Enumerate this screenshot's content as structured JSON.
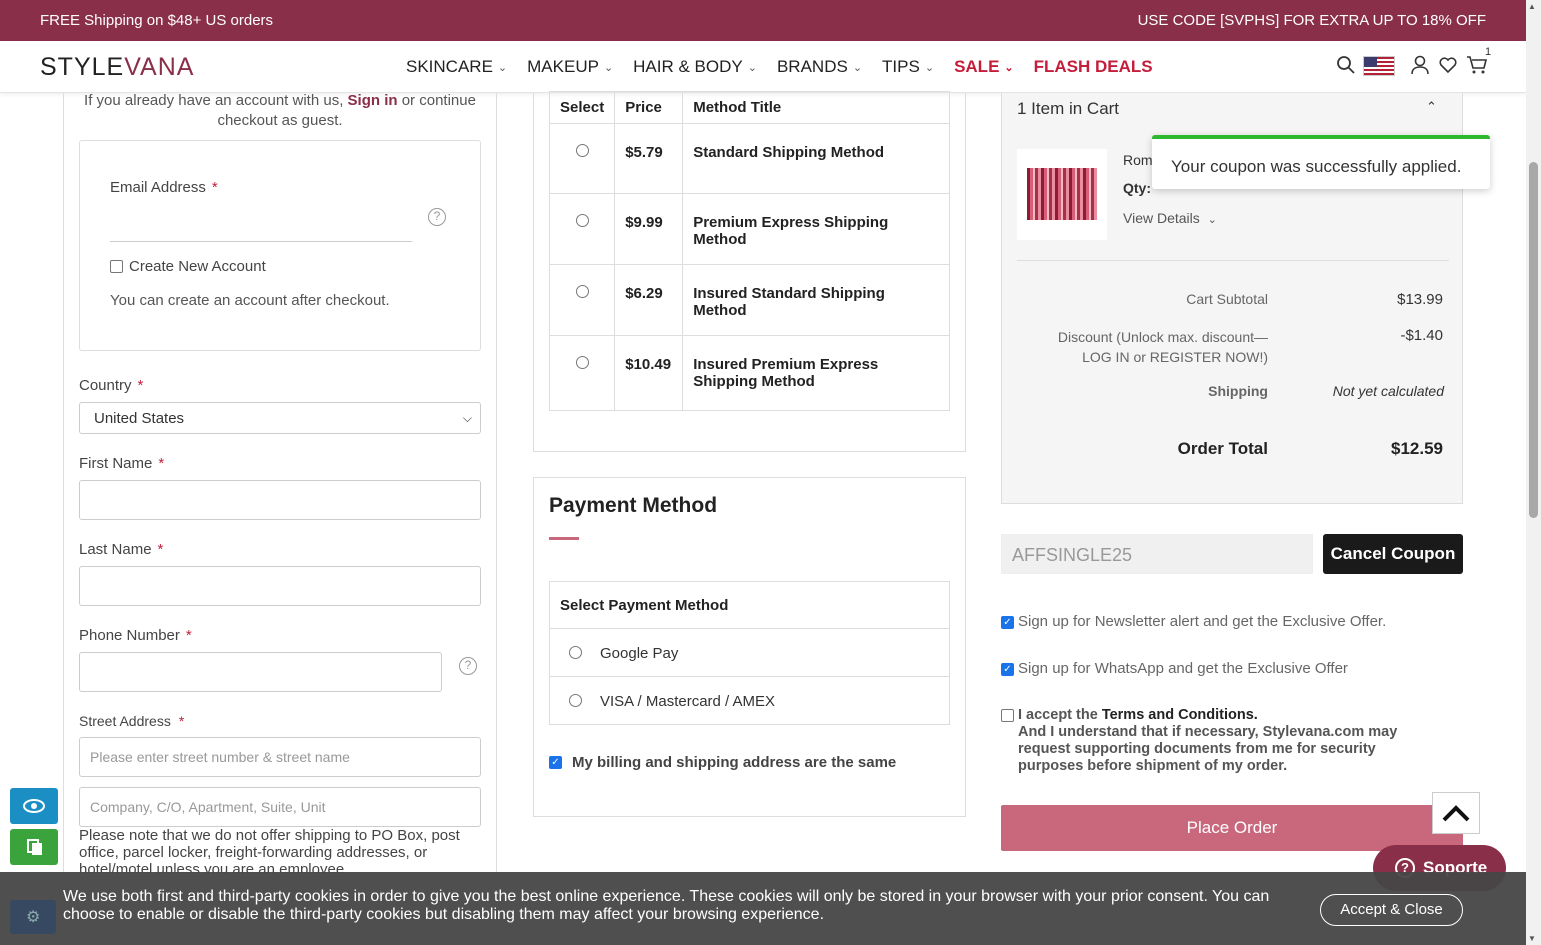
{
  "promo": {
    "left": "FREE Shipping on $48+ US orders",
    "right": "USE CODE [SVPHS] FOR EXTRA UP TO 18% OFF"
  },
  "header": {
    "logo_a": "STYLE",
    "logo_b": "VANA",
    "nav": [
      "SKINCARE",
      "MAKEUP",
      "HAIR & BODY",
      "BRANDS",
      "TIPS",
      "SALE",
      "FLASH DEALS"
    ],
    "cart_count": "1"
  },
  "account": {
    "line1": "If you already have an account with us,",
    "signin": "Sign in",
    "line1b": "or continue",
    "line2": "checkout as guest.",
    "email_label": "Email Address",
    "create_label": "Create New Account",
    "create_note": "You can create an account after checkout."
  },
  "form": {
    "country_label": "Country",
    "country_value": "United States",
    "first_name_label": "First Name",
    "last_name_label": "Last Name",
    "phone_label": "Phone Number",
    "street_label": "Street Address",
    "street_placeholder1": "Please enter street number & street name",
    "street_placeholder2": "Company, C/O, Apartment, Suite, Unit",
    "po_note": "Please note that we do not offer shipping to PO Box, post office, parcel locker, freight-forwarding addresses, or hotel/motel unless you are an employee."
  },
  "shipping": {
    "headers": [
      "Select",
      "Price",
      "Method Title"
    ],
    "rows": [
      {
        "price": "$5.79",
        "title": "Standard Shipping Method"
      },
      {
        "price": "$9.99",
        "title": "Premium Express Shipping Method"
      },
      {
        "price": "$6.29",
        "title": "Insured Standard Shipping Method"
      },
      {
        "price": "$10.49",
        "title": "Insured Premium Express Shipping Method"
      }
    ]
  },
  "payment": {
    "title": "Payment Method",
    "select_label": "Select Payment Method",
    "options": [
      "Google Pay",
      "VISA / Mastercard / AMEX"
    ],
    "billing_same": "My billing and shipping address are the same"
  },
  "summary": {
    "items_in_cart": "1 Item in Cart",
    "item_name_partial": "Rom",
    "qty_label": "Qty:",
    "view_details": "View Details",
    "toast": "Your coupon was successfully applied.",
    "subtotal_label": "Cart Subtotal",
    "subtotal": "$13.99",
    "discount_label": "Discount (Unlock max. discount—LOG IN or REGISTER NOW!)",
    "discount": "-$1.40",
    "shipping_label": "Shipping",
    "shipping_value": "Not yet calculated",
    "total_label": "Order Total",
    "total": "$12.59"
  },
  "coupon": {
    "code": "AFFSINGLE25",
    "cancel": "Cancel Coupon"
  },
  "optins": {
    "newsletter": "Sign up for Newsletter alert and get the Exclusive Offer.",
    "whatsapp": "Sign up for WhatsApp and get the Exclusive Offer",
    "terms_a": "I accept the",
    "terms_b": "Terms and Conditions.",
    "terms_c": "And I understand that if necessary, Stylevana.com may request supporting documents from me for security purposes before shipment of my order."
  },
  "place_order": "Place Order",
  "support": "Soporte",
  "cookie": {
    "text": "We use both first and third-party cookies in order to give you the best online experience. These cookies will only be stored in your browser with your prior consent. You can choose to enable or disable the third-party cookies but disabling them may affect your browsing experience.",
    "accept": "Accept & Close"
  },
  "colors": {
    "brand": "#8a2f4a",
    "sale": "#c41e3a",
    "place_order": "#c9687d",
    "toast_bar": "#2eb82e"
  }
}
